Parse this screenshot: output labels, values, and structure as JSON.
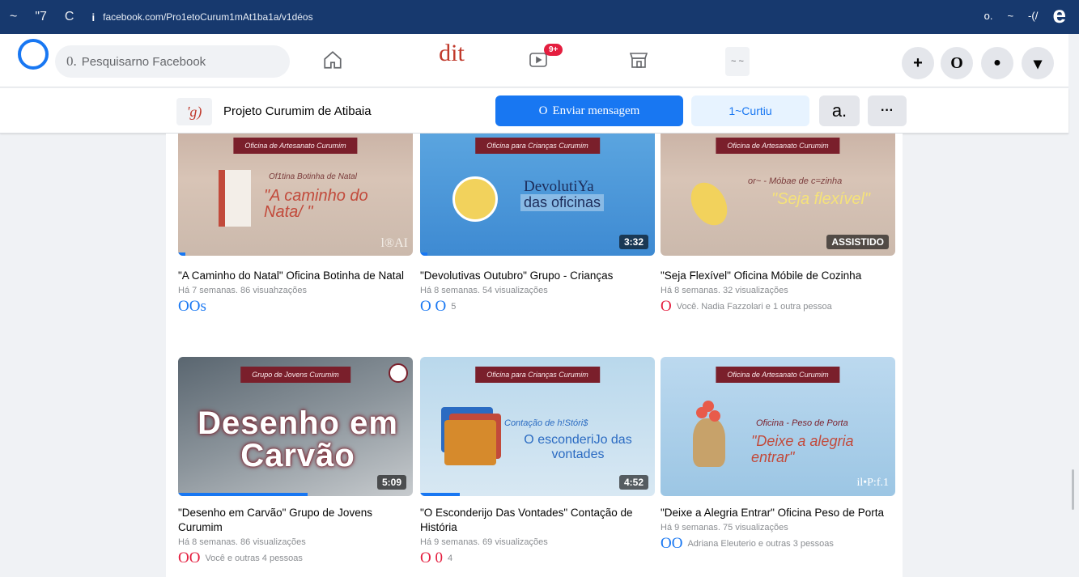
{
  "browser": {
    "nav_back": "~",
    "nav_fwd": "\"7",
    "reload": "C",
    "info": "i",
    "url": "facebook.com/Pro1etoCurum1mAt1ba1a/v1déos",
    "right_a": "o.",
    "right_b": "~",
    "right_c": "-(/",
    "right_e": "e"
  },
  "topbar": {
    "search_q": "0.",
    "search_placeholder": "Pesquisarno Facebook",
    "dit": "dit",
    "badge": "9+",
    "groups_glyph": "~ ~",
    "btn_plus": "+",
    "btn_o": "O",
    "btn_dot": "●",
    "btn_caret": "▾"
  },
  "page": {
    "icon": "'g)",
    "name": "Projeto Curumim de Atibaia",
    "message_icon": "O",
    "message_label": "Enviar mensagem",
    "like_label": "1~Curtiu",
    "a_label": "a.",
    "more_label": "···"
  },
  "videos": [
    {
      "ribbon": "Oficina de Artesanato Curumim",
      "art_small": "Of1tina Botinha de Natal",
      "art_main": "\"A caminho do Nata/ \"",
      "corner": "l®AI",
      "duration": "",
      "progress": 0.03,
      "title": "\"A Caminho do Natal\" Oficina Botinha de Natal",
      "meta": "Há 7 semanas. 86 visuahzações",
      "react_icons": "OOs",
      "react_text": "",
      "theme": "#c24a3b"
    },
    {
      "ribbon": "Oficina para Crianças Curumim",
      "art_small": "DevolutiYa",
      "art_main": "das oficinas",
      "corner": "",
      "duration": "3:32",
      "progress": 0.03,
      "title": "\"Devolutivas Outubro\" Grupo - Crianças",
      "meta": "Há 8 semanas. 54 visualizações",
      "react_icons": "O O",
      "react_text": "5",
      "theme": "#2b6bc2"
    },
    {
      "ribbon": "Oficina de Artesanato Curumim",
      "art_small": "or~ - Móbae de c=zinha",
      "art_main": "\"Seja flexível\"",
      "corner": "",
      "duration": "ASSISTIDO",
      "progress": 0,
      "title": "\"Seja Flexível\" Oficina Móbile de Cozinha",
      "meta": "Há 8 semanas. 32 visualizações",
      "react_icons": "O",
      "react_text": "Você. Nadia Fazzolari e 1 outra pessoa",
      "theme": "#e8c53a"
    },
    {
      "ribbon": "Grupo de Jovens Curumim",
      "art_small": "",
      "art_main": "Desenho em Carvão",
      "corner": "",
      "duration": "5:09",
      "progress": 0.55,
      "title": "\"Desenho em Carvão\" Grupo de Jovens Curumim",
      "meta": "Há 8 semanas. 86 visualizações",
      "react_icons": "OO",
      "react_text": "Você e outras 4 pessoas",
      "theme": "#7a1f2b"
    },
    {
      "ribbon": "Oficina para Crianças Curumim",
      "art_small": "Contação de h!Stóri$",
      "art_main": "O esconderiJo das vontades",
      "corner": "",
      "duration": "4:52",
      "progress": 0.17,
      "title": "\"O Esconderijo Das Vontades\" Contação de História",
      "meta": "Há 9 semanas. 69 visualizações",
      "react_icons": "O 0",
      "react_text": "4",
      "theme": "#3a7fd0"
    },
    {
      "ribbon": "Oficina de Artesanato Curumim",
      "art_small": "Oficina - Peso de Porta",
      "art_main": "\"Deixe a alegria entrar\"",
      "corner": "il•P:f.1",
      "duration": "",
      "progress": 0,
      "title": "\"Deixe a Alegria Entrar\" Oficina Peso de Porta",
      "meta": "Há 9 semanas. 75 visualizações",
      "react_icons": "OO",
      "react_text": "Adriana Eleuterio e outras 3 pessoas",
      "theme": "#c24a3b"
    }
  ]
}
